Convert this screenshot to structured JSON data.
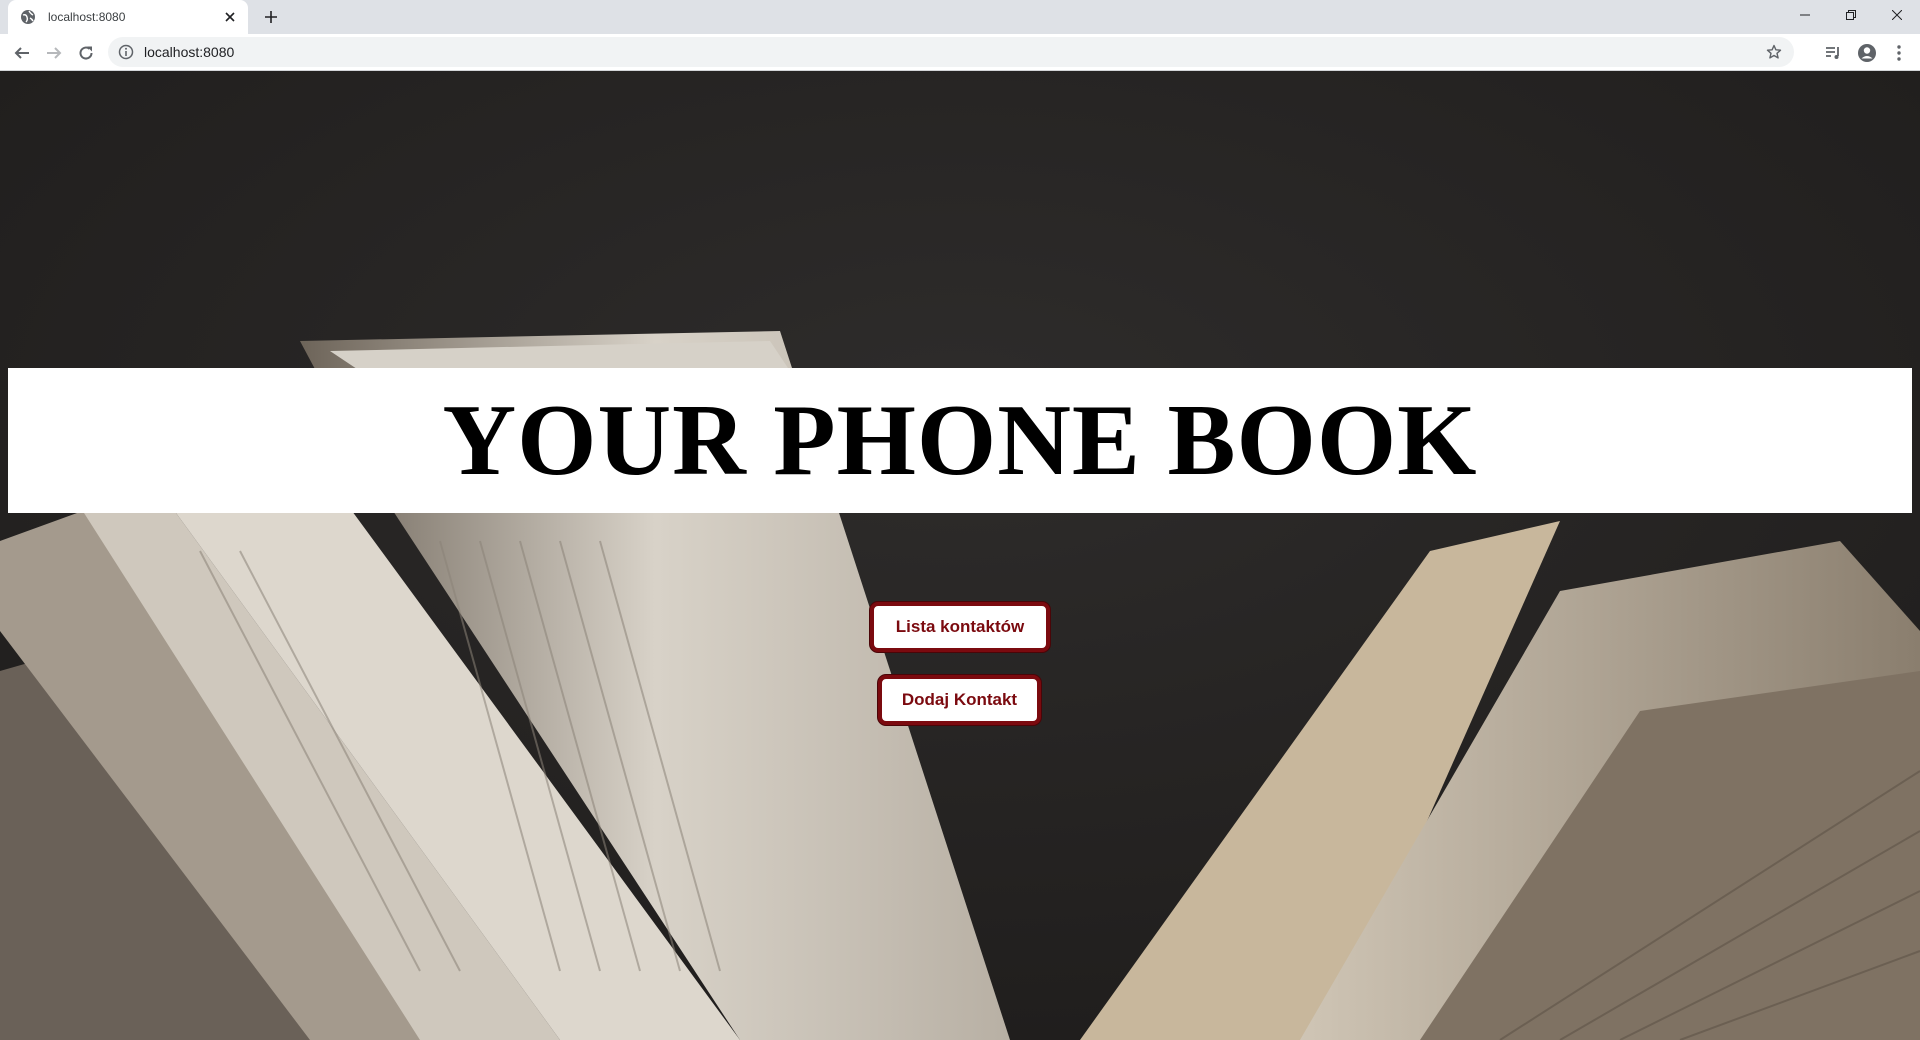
{
  "browser": {
    "tab_title": "localhost:8080",
    "url": "localhost:8080",
    "icons": {
      "favicon": "globe-icon",
      "tab_close": "close-icon",
      "new_tab": "plus-icon",
      "back": "arrow-left-icon",
      "forward": "arrow-right-icon",
      "reload": "reload-icon",
      "site_info": "info-icon",
      "bookmark": "star-icon",
      "media": "media-queue-icon",
      "profile": "profile-icon",
      "menu": "kebab-menu-icon",
      "minimize": "minimize-icon",
      "maximize": "restore-icon",
      "window_close": "window-close-icon"
    }
  },
  "page": {
    "title": "YOUR PHONE BOOK",
    "buttons": {
      "contacts_list": "Lista kontaktów",
      "add_contact": "Dodaj Kontakt"
    },
    "colors": {
      "banner_background": "#ffffff",
      "title_text": "#000000",
      "button_border": "#7b0a0f",
      "button_text": "#7b0a0f",
      "page_background": "#262423"
    }
  }
}
